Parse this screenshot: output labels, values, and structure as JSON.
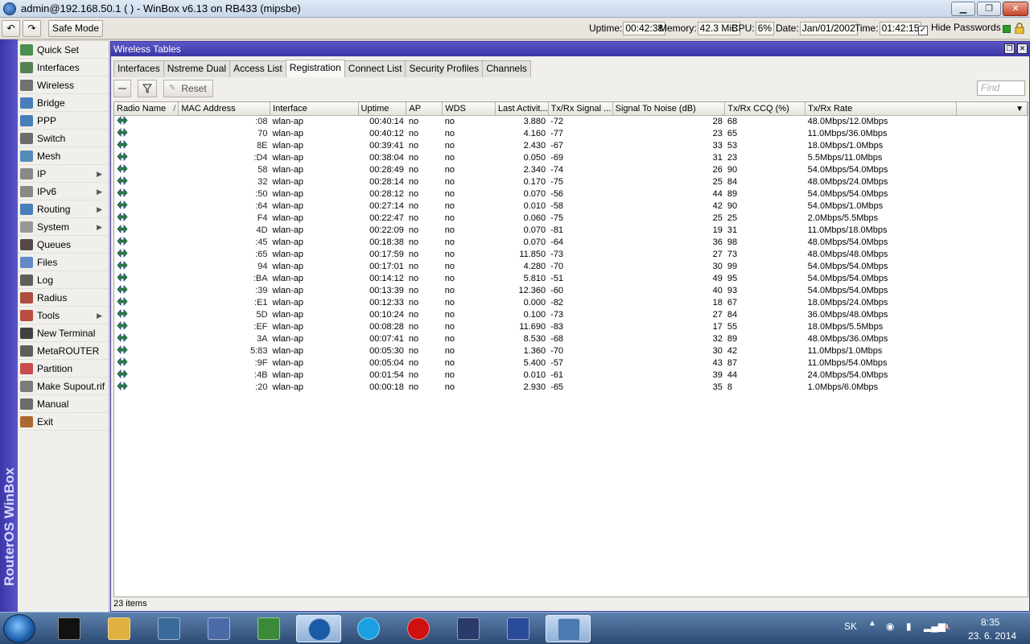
{
  "window": {
    "title": "admin@192.168.50.1 ( ) - WinBox v6.13 on RB433 (mipsbe)"
  },
  "toolbar": {
    "undo_label": "↶",
    "redo_label": "↷",
    "safe_mode_label": "Safe Mode",
    "uptime_label": "Uptime:",
    "uptime_value": "00:42:38",
    "memory_label": "Memory:",
    "memory_value": "42.3 MiB",
    "cpu_label": "CPU:",
    "cpu_value": "6%",
    "date_label": "Date:",
    "date_value": "Jan/01/2002",
    "time_label": "Time:",
    "time_value": "01:42:15",
    "hide_passwords_label": "Hide Passwords",
    "hide_passwords_checked": true
  },
  "brand": {
    "text": "RouterOS WinBox"
  },
  "menu": {
    "items": [
      {
        "label": "Quick Set",
        "icon": "quickset-icon",
        "sub": false
      },
      {
        "label": "Interfaces",
        "icon": "interfaces-icon",
        "sub": false
      },
      {
        "label": "Wireless",
        "icon": "wireless-icon",
        "sub": false
      },
      {
        "label": "Bridge",
        "icon": "bridge-icon",
        "sub": false
      },
      {
        "label": "PPP",
        "icon": "ppp-icon",
        "sub": false
      },
      {
        "label": "Switch",
        "icon": "switch-icon",
        "sub": false
      },
      {
        "label": "Mesh",
        "icon": "mesh-icon",
        "sub": false
      },
      {
        "label": "IP",
        "icon": "ip-icon",
        "sub": true
      },
      {
        "label": "IPv6",
        "icon": "ipv6-icon",
        "sub": true
      },
      {
        "label": "Routing",
        "icon": "routing-icon",
        "sub": true
      },
      {
        "label": "System",
        "icon": "system-icon",
        "sub": true
      },
      {
        "label": "Queues",
        "icon": "queues-icon",
        "sub": false
      },
      {
        "label": "Files",
        "icon": "files-icon",
        "sub": false
      },
      {
        "label": "Log",
        "icon": "log-icon",
        "sub": false
      },
      {
        "label": "Radius",
        "icon": "radius-icon",
        "sub": false
      },
      {
        "label": "Tools",
        "icon": "tools-icon",
        "sub": true
      },
      {
        "label": "New Terminal",
        "icon": "terminal-icon",
        "sub": false
      },
      {
        "label": "MetaROUTER",
        "icon": "metarouter-icon",
        "sub": false
      },
      {
        "label": "Partition",
        "icon": "partition-icon",
        "sub": false
      },
      {
        "label": "Make Supout.rif",
        "icon": "supout-icon",
        "sub": false
      },
      {
        "label": "Manual",
        "icon": "manual-icon",
        "sub": false
      },
      {
        "label": "Exit",
        "icon": "exit-icon",
        "sub": false
      }
    ]
  },
  "wireless_tables": {
    "title": "Wireless Tables",
    "tabs": [
      "Interfaces",
      "Nstreme Dual",
      "Access List",
      "Registration",
      "Connect List",
      "Security Profiles",
      "Channels"
    ],
    "active_tab": "Registration",
    "reset_label": "Reset",
    "find_placeholder": "Find",
    "columns": [
      "Radio Name",
      "MAC Address",
      "Interface",
      "Uptime",
      "AP",
      "WDS",
      "Last Activit...",
      "Tx/Rx Signal ...",
      "Signal To Noise (dB)",
      "Tx/Rx CCQ (%)",
      "Tx/Rx Rate"
    ],
    "sort_indicator": "/",
    "rows": [
      {
        "mac": ":08",
        "iface": "wlan-ap",
        "uptime": "00:40:14",
        "ap": "no",
        "wds": "no",
        "last": "3.880",
        "signal": "-72",
        "snr": "28",
        "ccq": "68",
        "rate": "48.0Mbps/12.0Mbps"
      },
      {
        "mac": "70",
        "iface": "wlan-ap",
        "uptime": "00:40:12",
        "ap": "no",
        "wds": "no",
        "last": "4.160",
        "signal": "-77",
        "snr": "23",
        "ccq": "65",
        "rate": "11.0Mbps/36.0Mbps"
      },
      {
        "mac": "8E",
        "iface": "wlan-ap",
        "uptime": "00:39:41",
        "ap": "no",
        "wds": "no",
        "last": "2.430",
        "signal": "-67",
        "snr": "33",
        "ccq": "53",
        "rate": "18.0Mbps/1.0Mbps"
      },
      {
        "mac": ":D4",
        "iface": "wlan-ap",
        "uptime": "00:38:04",
        "ap": "no",
        "wds": "no",
        "last": "0.050",
        "signal": "-69",
        "snr": "31",
        "ccq": "23",
        "rate": "5.5Mbps/11.0Mbps"
      },
      {
        "mac": "58",
        "iface": "wlan-ap",
        "uptime": "00:28:49",
        "ap": "no",
        "wds": "no",
        "last": "2.340",
        "signal": "-74",
        "snr": "26",
        "ccq": "90",
        "rate": "54.0Mbps/54.0Mbps"
      },
      {
        "mac": "32",
        "iface": "wlan-ap",
        "uptime": "00:28:14",
        "ap": "no",
        "wds": "no",
        "last": "0.170",
        "signal": "-75",
        "snr": "25",
        "ccq": "84",
        "rate": "48.0Mbps/24.0Mbps"
      },
      {
        "mac": ":50",
        "iface": "wlan-ap",
        "uptime": "00:28:12",
        "ap": "no",
        "wds": "no",
        "last": "0.070",
        "signal": "-56",
        "snr": "44",
        "ccq": "89",
        "rate": "54.0Mbps/54.0Mbps"
      },
      {
        "mac": ":64",
        "iface": "wlan-ap",
        "uptime": "00:27:14",
        "ap": "no",
        "wds": "no",
        "last": "0.010",
        "signal": "-58",
        "snr": "42",
        "ccq": "90",
        "rate": "54.0Mbps/1.0Mbps"
      },
      {
        "mac": "F4",
        "iface": "wlan-ap",
        "uptime": "00:22:47",
        "ap": "no",
        "wds": "no",
        "last": "0.060",
        "signal": "-75",
        "snr": "25",
        "ccq": "25",
        "rate": "2.0Mbps/5.5Mbps"
      },
      {
        "mac": "4D",
        "iface": "wlan-ap",
        "uptime": "00:22:09",
        "ap": "no",
        "wds": "no",
        "last": "0.070",
        "signal": "-81",
        "snr": "19",
        "ccq": "31",
        "rate": "11.0Mbps/18.0Mbps"
      },
      {
        "mac": ":45",
        "iface": "wlan-ap",
        "uptime": "00:18:38",
        "ap": "no",
        "wds": "no",
        "last": "0.070",
        "signal": "-64",
        "snr": "36",
        "ccq": "98",
        "rate": "48.0Mbps/54.0Mbps"
      },
      {
        "mac": ":65",
        "iface": "wlan-ap",
        "uptime": "00:17:59",
        "ap": "no",
        "wds": "no",
        "last": "11.850",
        "signal": "-73",
        "snr": "27",
        "ccq": "73",
        "rate": "48.0Mbps/48.0Mbps"
      },
      {
        "mac": "94",
        "iface": "wlan-ap",
        "uptime": "00:17:01",
        "ap": "no",
        "wds": "no",
        "last": "4.280",
        "signal": "-70",
        "snr": "30",
        "ccq": "99",
        "rate": "54.0Mbps/54.0Mbps"
      },
      {
        "mac": ":BA",
        "iface": "wlan-ap",
        "uptime": "00:14:12",
        "ap": "no",
        "wds": "no",
        "last": "5.810",
        "signal": "-51",
        "snr": "49",
        "ccq": "95",
        "rate": "54.0Mbps/54.0Mbps"
      },
      {
        "mac": ":39",
        "iface": "wlan-ap",
        "uptime": "00:13:39",
        "ap": "no",
        "wds": "no",
        "last": "12.360",
        "signal": "-60",
        "snr": "40",
        "ccq": "93",
        "rate": "54.0Mbps/54.0Mbps"
      },
      {
        "mac": ":E1",
        "iface": "wlan-ap",
        "uptime": "00:12:33",
        "ap": "no",
        "wds": "no",
        "last": "0.000",
        "signal": "-82",
        "snr": "18",
        "ccq": "67",
        "rate": "18.0Mbps/24.0Mbps"
      },
      {
        "mac": "5D",
        "iface": "wlan-ap",
        "uptime": "00:10:24",
        "ap": "no",
        "wds": "no",
        "last": "0.100",
        "signal": "-73",
        "snr": "27",
        "ccq": "84",
        "rate": "36.0Mbps/48.0Mbps"
      },
      {
        "mac": ":EF",
        "iface": "wlan-ap",
        "uptime": "00:08:28",
        "ap": "no",
        "wds": "no",
        "last": "11.690",
        "signal": "-83",
        "snr": "17",
        "ccq": "55",
        "rate": "18.0Mbps/5.5Mbps"
      },
      {
        "mac": "3A",
        "iface": "wlan-ap",
        "uptime": "00:07:41",
        "ap": "no",
        "wds": "no",
        "last": "8.530",
        "signal": "-68",
        "snr": "32",
        "ccq": "89",
        "rate": "48.0Mbps/36.0Mbps"
      },
      {
        "mac": "5:83",
        "iface": "wlan-ap",
        "uptime": "00:05:30",
        "ap": "no",
        "wds": "no",
        "last": "1.360",
        "signal": "-70",
        "snr": "30",
        "ccq": "42",
        "rate": "11.0Mbps/1.0Mbps"
      },
      {
        "mac": ":9F",
        "iface": "wlan-ap",
        "uptime": "00:05:04",
        "ap": "no",
        "wds": "no",
        "last": "5.400",
        "signal": "-57",
        "snr": "43",
        "ccq": "87",
        "rate": "11.0Mbps/54.0Mbps"
      },
      {
        "mac": ":4B",
        "iface": "wlan-ap",
        "uptime": "00:01:54",
        "ap": "no",
        "wds": "no",
        "last": "0.010",
        "signal": "-61",
        "snr": "39",
        "ccq": "44",
        "rate": "24.0Mbps/54.0Mbps"
      },
      {
        "mac": ":20",
        "iface": "wlan-ap",
        "uptime": "00:00:18",
        "ap": "no",
        "wds": "no",
        "last": "2.930",
        "signal": "-65",
        "snr": "35",
        "ccq": "8",
        "rate": "1.0Mbps/6.0Mbps"
      }
    ],
    "footer": "23 items"
  },
  "taskbar": {
    "apps": [
      "cmd-icon",
      "explorer-icon",
      "network-icon",
      "virtualbox-icon",
      "security-icon",
      "winbox-icon",
      "skype-icon",
      "opera-icon",
      "download-icon",
      "remote-desktop-icon",
      "control-panel-icon"
    ],
    "language": "SK",
    "clock_time": "8:35",
    "clock_date": "23. 6. 2014"
  },
  "colors": {
    "brand_blue": "#3b36a8",
    "taskbar": "#2c4a73"
  }
}
